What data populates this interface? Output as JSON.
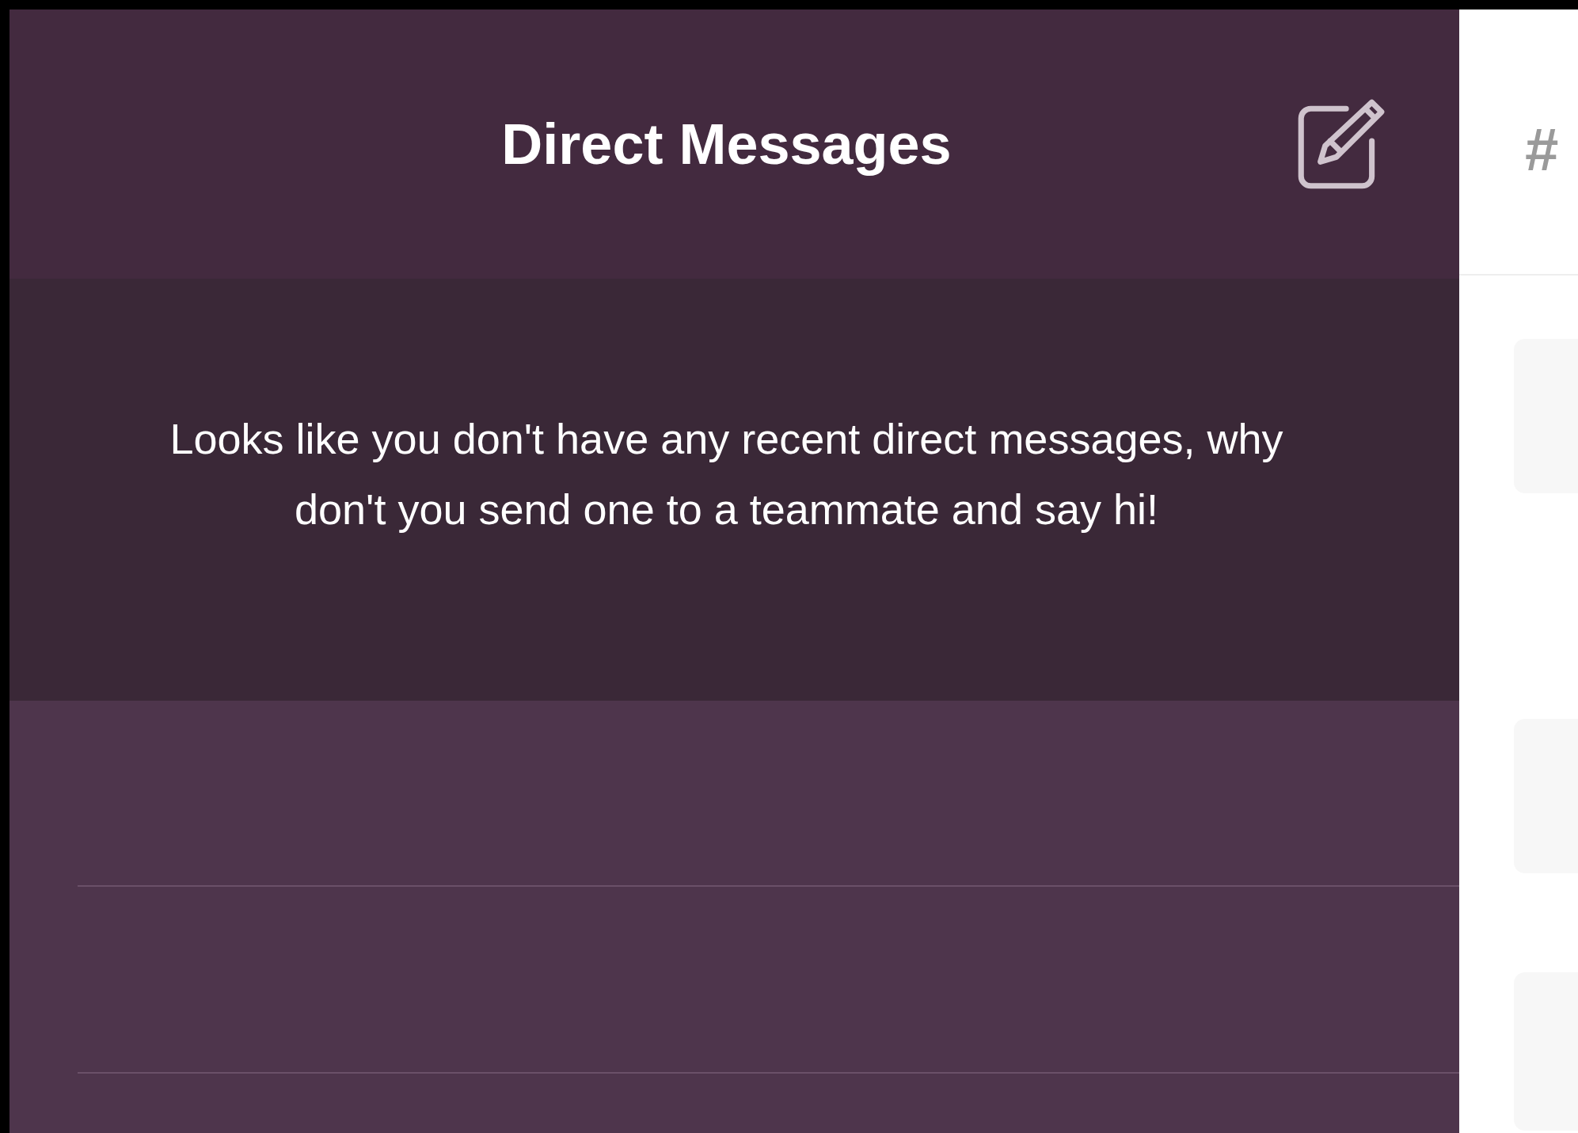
{
  "sidebar": {
    "title": "Direct Messages",
    "empty_message": "Looks like you don't have any recent direct messages, why don't you send one to a teammate and say hi!"
  },
  "main": {
    "channel_prefix": "#"
  }
}
